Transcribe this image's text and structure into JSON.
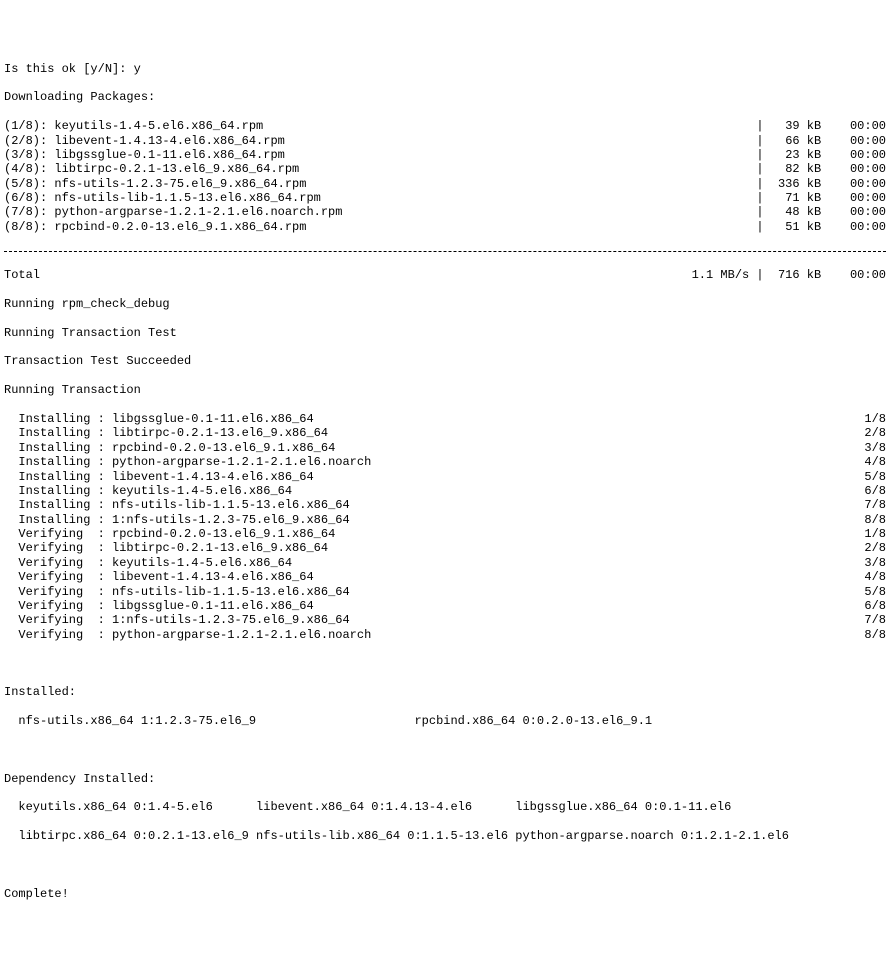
{
  "prompt": "Is this ok [y/N]: y",
  "downloading_header": "Downloading Packages:",
  "downloads": [
    {
      "idx": "(1/8)",
      "colon": ":",
      "name": " keyutils-1.4-5.el6.x86_64.rpm",
      "size": "39 kB",
      "time": "00:00"
    },
    {
      "idx": "(2/8)",
      "colon": ":",
      "name": " libevent-1.4.13-4.el6.x86_64.rpm",
      "size": "66 kB",
      "time": "00:00"
    },
    {
      "idx": "(3/8)",
      "colon": ":",
      "name": " libgssglue-0.1-11.el6.x86_64.rpm",
      "size": "23 kB",
      "time": "00:00"
    },
    {
      "idx": "(4/8)",
      "colon": ":",
      "name": " libtirpc-0.2.1-13.el6_9.x86_64.rpm",
      "size": "82 kB",
      "time": "00:00"
    },
    {
      "idx": "(5/8)",
      "colon": ":",
      "name": " nfs-utils-1.2.3-75.el6_9.x86_64.rpm",
      "size": "336 kB",
      "time": "00:00"
    },
    {
      "idx": "(6/8)",
      "colon": ":",
      "name": " nfs-utils-lib-1.1.5-13.el6.x86_64.rpm",
      "size": "71 kB",
      "time": "00:00"
    },
    {
      "idx": "(7/8)",
      "colon": ":",
      "name": " python-argparse-1.2.1-2.1.el6.noarch.rpm",
      "size": "48 kB",
      "time": "00:00"
    },
    {
      "idx": "(8/8)",
      "colon": ":",
      "name": " rpcbind-0.2.0-13.el6_9.1.x86_64.rpm",
      "size": "51 kB",
      "time": "00:00"
    }
  ],
  "total_label": "Total",
  "total_speed": "1.1 MB/s",
  "total_size": "716 kB",
  "total_time": "00:00",
  "rpm_check": "Running rpm_check_debug",
  "trans_test": "Running Transaction Test",
  "trans_succeed": "Transaction Test Succeeded",
  "trans_run": "Running Transaction",
  "steps": [
    {
      "action": "  Installing : ",
      "pkg": "libgssglue-0.1-11.el6.x86_64",
      "idx": "1/8"
    },
    {
      "action": "  Installing : ",
      "pkg": "libtirpc-0.2.1-13.el6_9.x86_64",
      "idx": "2/8"
    },
    {
      "action": "  Installing : ",
      "pkg": "rpcbind-0.2.0-13.el6_9.1.x86_64",
      "idx": "3/8"
    },
    {
      "action": "  Installing : ",
      "pkg": "python-argparse-1.2.1-2.1.el6.noarch",
      "idx": "4/8"
    },
    {
      "action": "  Installing : ",
      "pkg": "libevent-1.4.13-4.el6.x86_64",
      "idx": "5/8"
    },
    {
      "action": "  Installing : ",
      "pkg": "keyutils-1.4-5.el6.x86_64",
      "idx": "6/8"
    },
    {
      "action": "  Installing : ",
      "pkg": "nfs-utils-lib-1.1.5-13.el6.x86_64",
      "idx": "7/8"
    },
    {
      "action": "  Installing : ",
      "pkg": "1:nfs-utils-1.2.3-75.el6_9.x86_64",
      "idx": "8/8"
    },
    {
      "action": "  Verifying  : ",
      "pkg": "rpcbind-0.2.0-13.el6_9.1.x86_64",
      "idx": "1/8"
    },
    {
      "action": "  Verifying  : ",
      "pkg": "libtirpc-0.2.1-13.el6_9.x86_64",
      "idx": "2/8"
    },
    {
      "action": "  Verifying  : ",
      "pkg": "keyutils-1.4-5.el6.x86_64",
      "idx": "3/8"
    },
    {
      "action": "  Verifying  : ",
      "pkg": "libevent-1.4.13-4.el6.x86_64",
      "idx": "4/8"
    },
    {
      "action": "  Verifying  : ",
      "pkg": "nfs-utils-lib-1.1.5-13.el6.x86_64",
      "idx": "5/8"
    },
    {
      "action": "  Verifying  : ",
      "pkg": "libgssglue-0.1-11.el6.x86_64",
      "idx": "6/8"
    },
    {
      "action": "  Verifying  : ",
      "pkg": "1:nfs-utils-1.2.3-75.el6_9.x86_64",
      "idx": "7/8"
    },
    {
      "action": "  Verifying  : ",
      "pkg": "python-argparse-1.2.1-2.1.el6.noarch",
      "idx": "8/8"
    }
  ],
  "installed_header": "Installed:",
  "installed_line": "  nfs-utils.x86_64 1:1.2.3-75.el6_9                      rpcbind.x86_64 0:0.2.0-13.el6_9.1",
  "dep_header": "Dependency Installed:",
  "dep_line1": "  keyutils.x86_64 0:1.4-5.el6      libevent.x86_64 0:1.4.13-4.el6      libgssglue.x86_64 0:0.1-11.el6",
  "dep_line2": "  libtirpc.x86_64 0:0.2.1-13.el6_9 nfs-utils-lib.x86_64 0:1.1.5-13.el6 python-argparse.noarch 0:1.2.1-2.1.el6",
  "complete": "Complete!"
}
